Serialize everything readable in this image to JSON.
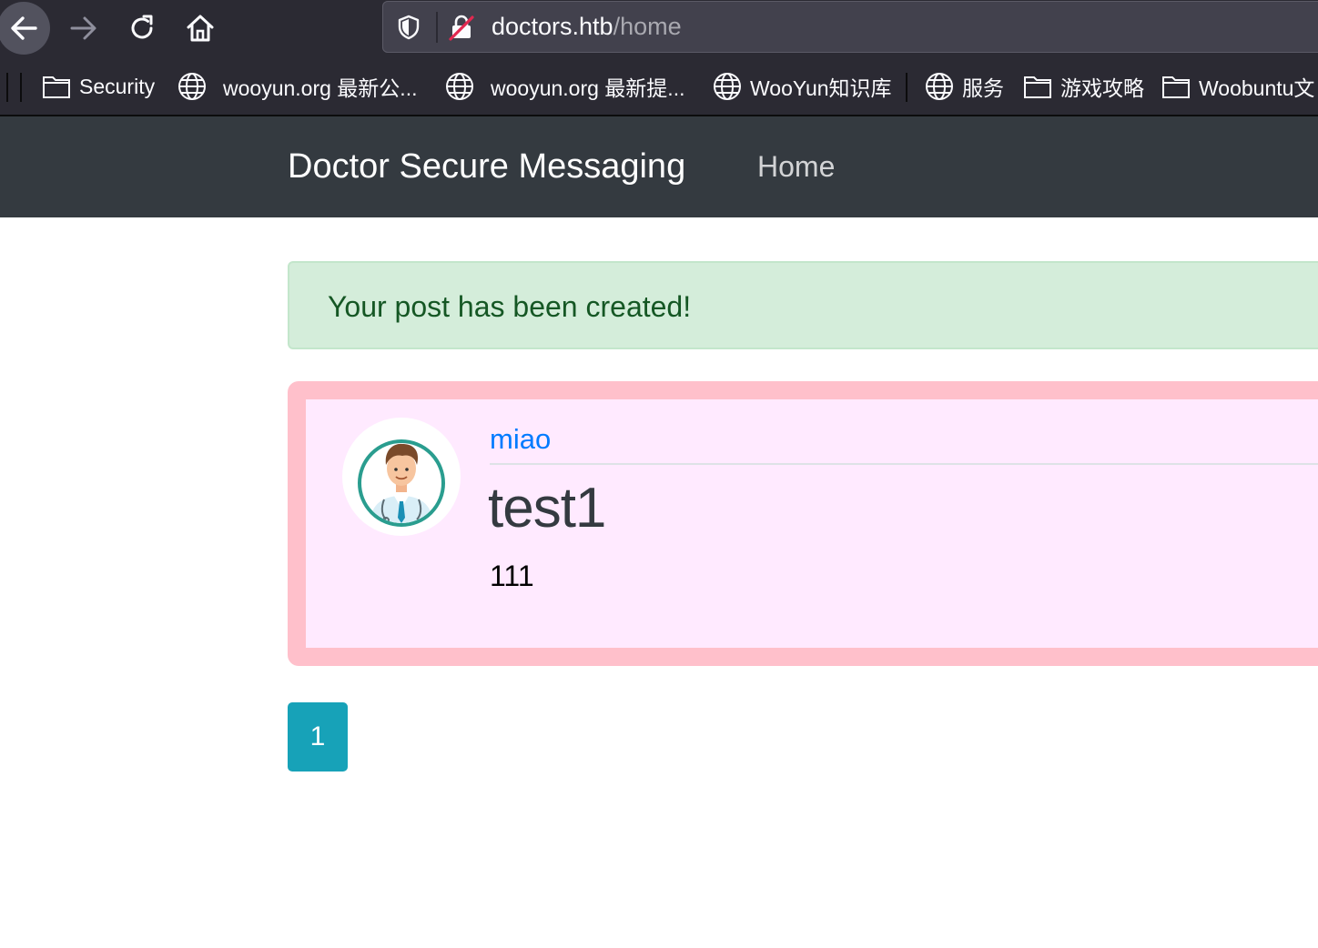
{
  "browser": {
    "url_domain": "doctors.htb",
    "url_path": "/home",
    "bookmarks": [
      {
        "label": "Security",
        "icon": "folder-icon"
      },
      {
        "label": "wooyun.org 最新公...",
        "icon": "globe-icon"
      },
      {
        "label": "wooyun.org 最新提...",
        "icon": "globe-icon"
      },
      {
        "label": "WooYun知识库",
        "icon": "globe-icon"
      },
      {
        "label": "服务",
        "icon": "globe-icon"
      },
      {
        "label": "游戏攻略",
        "icon": "folder-icon"
      },
      {
        "label": "Woobuntu文",
        "icon": "folder-icon"
      }
    ]
  },
  "navbar": {
    "brand": "Doctor Secure Messaging",
    "home_label": "Home"
  },
  "alert": {
    "message": "Your post has been created!",
    "color": "#155724"
  },
  "post": {
    "author": "miao",
    "title": "test1",
    "content": "111",
    "background": "#ffeaff",
    "border_color": "#ffc0cb"
  },
  "pagination": {
    "current_page": "1",
    "color": "#17a2b8"
  }
}
